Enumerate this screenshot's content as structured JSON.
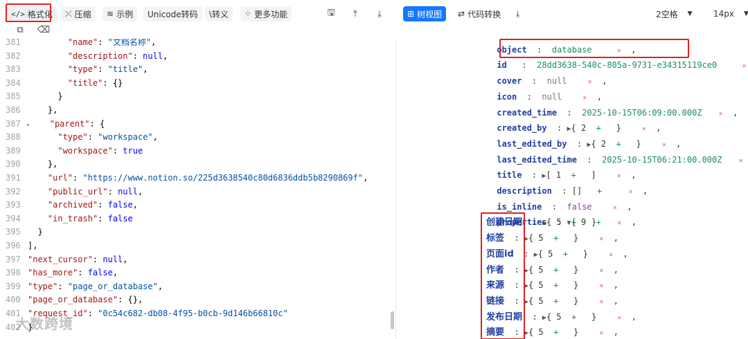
{
  "left_toolbar": {
    "format_label": "格式化",
    "compress_label": "压缩",
    "example_label": "示例",
    "unicode_label": "Unicode转码",
    "escape_label": "\\转义",
    "more_label": "更多功能"
  },
  "code_lines": [
    {
      "n": "381",
      "text": "        \"name\": \"文档名称\","
    },
    {
      "n": "382",
      "text": "        \"description\": null,"
    },
    {
      "n": "383",
      "text": "        \"type\": \"title\","
    },
    {
      "n": "384",
      "text": "        \"title\": {}"
    },
    {
      "n": "385",
      "text": "      }"
    },
    {
      "n": "386",
      "text": "    },"
    },
    {
      "n": "387",
      "text": "    \"parent\": {",
      "fold": "▾"
    },
    {
      "n": "388",
      "text": "      \"type\": \"workspace\","
    },
    {
      "n": "389",
      "text": "      \"workspace\": true"
    },
    {
      "n": "390",
      "text": "    },"
    },
    {
      "n": "391",
      "text": "    \"url\": \"https://www.notion.so/225d3638540c80d6836ddb5b8290869f\","
    },
    {
      "n": "392",
      "text": "    \"public_url\": null,"
    },
    {
      "n": "393",
      "text": "    \"archived\": false,"
    },
    {
      "n": "394",
      "text": "    \"in_trash\": false"
    },
    {
      "n": "395",
      "text": "  }"
    },
    {
      "n": "396",
      "text": "],"
    },
    {
      "n": "397",
      "text": "\"next_cursor\": null,"
    },
    {
      "n": "398",
      "text": "\"has_more\": false,"
    },
    {
      "n": "399",
      "text": "\"type\": \"page_or_database\","
    },
    {
      "n": "400",
      "text": "\"page_or_database\": {},"
    },
    {
      "n": "401",
      "text": "\"request_id\": \"0c54c682-db08-4f95-b0cb-9d146b66810c\""
    },
    {
      "n": "402",
      "text": "}"
    }
  ],
  "watermark": "大数跨境",
  "right_toolbar": {
    "tree_view_label": "树视图",
    "code_convert_label": "代码转换",
    "indent_value": "2空格",
    "font_size_value": "14px"
  },
  "tree": {
    "object_key": "object",
    "object_val": "database",
    "id_key": "id",
    "id_val": "28dd3638-540c-805a-9731-e34315119ce0",
    "cover_key": "cover",
    "cover_val": "null",
    "icon_key": "icon",
    "icon_val": "null",
    "created_time_key": "created_time",
    "created_time_val": "2025-10-15T06:09:00.000Z",
    "created_by_key": "created_by",
    "created_by_count": "2",
    "last_edited_by_key": "last_edited_by",
    "last_edited_by_count": "2",
    "last_edited_time_key": "last_edited_time",
    "last_edited_time_val": "2025-10-15T06:21:00.000Z",
    "title_key": "title",
    "title_count": "1",
    "description_key": "description",
    "description_val": "[]",
    "is_inline_key": "is_inline",
    "is_inline_val": "false",
    "properties_key": "properties",
    "properties_count": "9",
    "props": [
      {
        "key": "创建日期",
        "count": "5"
      },
      {
        "key": "标签",
        "count": "5"
      },
      {
        "key": "页面id",
        "count": "5"
      },
      {
        "key": "作者",
        "count": "5"
      },
      {
        "key": "来源",
        "count": "5"
      },
      {
        "key": "链接",
        "count": "5"
      },
      {
        "key": "发布日期",
        "count": "5"
      },
      {
        "key": "摘要",
        "count": "5"
      }
    ]
  },
  "colors": {
    "accent": "#1677ff",
    "highlight_box": "#e02020"
  }
}
